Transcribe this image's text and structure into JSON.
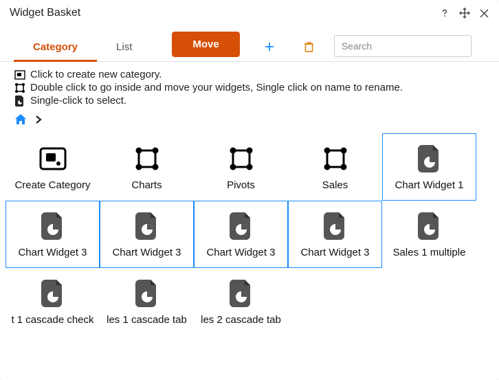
{
  "window": {
    "title": "Widget Basket"
  },
  "tabs": {
    "category": "Category",
    "list": "List",
    "active": "category"
  },
  "move_button": "Move",
  "search": {
    "placeholder": "Search"
  },
  "hints": {
    "create": "Click to create new category.",
    "move": "Double click to go inside and move your widgets, Single click on name to rename.",
    "select": "Single-click to select."
  },
  "items": [
    {
      "label": "Create Category",
      "type": "create",
      "selected": false
    },
    {
      "label": "Charts",
      "type": "category",
      "selected": false
    },
    {
      "label": "Pivots",
      "type": "category",
      "selected": false
    },
    {
      "label": "Sales",
      "type": "category",
      "selected": false
    },
    {
      "label": "Chart Widget 1",
      "type": "widget",
      "selected": true
    },
    {
      "label": "Chart Widget 3",
      "type": "widget",
      "selected": true
    },
    {
      "label": "Chart Widget 3",
      "type": "widget",
      "selected": true
    },
    {
      "label": "Chart Widget 3",
      "type": "widget",
      "selected": true
    },
    {
      "label": "Chart Widget 3",
      "type": "widget",
      "selected": true
    },
    {
      "label": "Sales 1 multiple",
      "type": "widget",
      "selected": false
    },
    {
      "label": "t 1 cascade check",
      "type": "widget",
      "selected": false
    },
    {
      "label": "les 1 cascade tab",
      "type": "widget",
      "selected": false
    },
    {
      "label": "les 2 cascade tab",
      "type": "widget",
      "selected": false
    }
  ]
}
